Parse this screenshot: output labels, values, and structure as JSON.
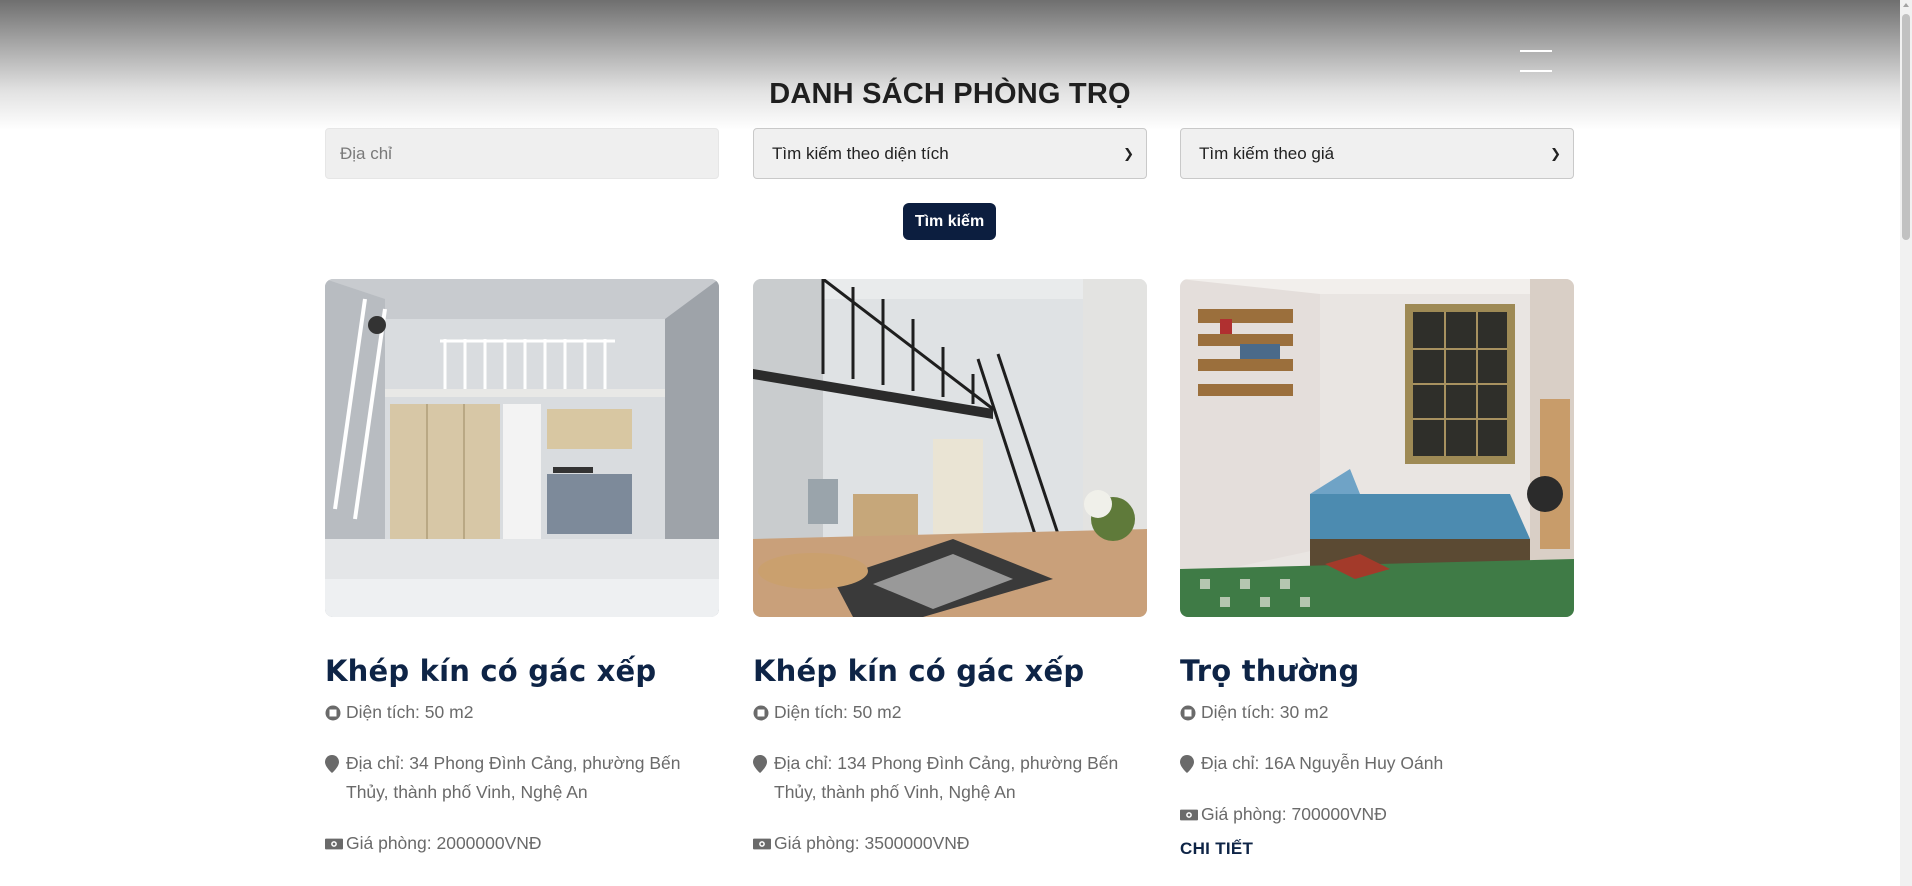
{
  "header": {
    "title": "DANH SÁCH PHÒNG TRỌ",
    "menu_icon": "hamburger-menu-icon"
  },
  "filters": {
    "address_placeholder": "Địa chỉ",
    "area_select": "Tìm kiếm theo diện tích",
    "price_select": "Tìm kiếm theo giá",
    "search_button": "Tìm kiếm"
  },
  "rooms": [
    {
      "title": "Khép kín có gác xếp",
      "area": "Diện tích: 50 m2",
      "address": "Địa chỉ: 34 Phong Đình Cảng, phường Bến Thủy, thành phố Vinh, Nghệ An",
      "price": "Giá phòng: 2000000VNĐ",
      "image": "loft-room-photo"
    },
    {
      "title": "Khép kín có gác xếp",
      "area": "Diện tích: 50 m2",
      "address": "Địa chỉ: 134 Phong Đình Cảng, phường Bến Thủy, thành phố Vinh, Nghệ An",
      "price": "Giá phòng: 3500000VNĐ",
      "image": "loft-room-stairs-photo"
    },
    {
      "title": "Trọ thường",
      "area": "Diện tích: 30 m2",
      "address": "Địa chỉ: 16A Nguyễn Huy Oánh",
      "price": "Giá phòng: 700000VNĐ",
      "detail": "CHI TIẾT",
      "image": "basic-room-photo"
    }
  ],
  "icons": {
    "area": "area-icon",
    "address": "map-marker-icon",
    "price": "money-icon"
  },
  "colors": {
    "brand_navy": "#0e2446",
    "button": "#0c1e3f",
    "text_muted": "#6a6a6a"
  }
}
